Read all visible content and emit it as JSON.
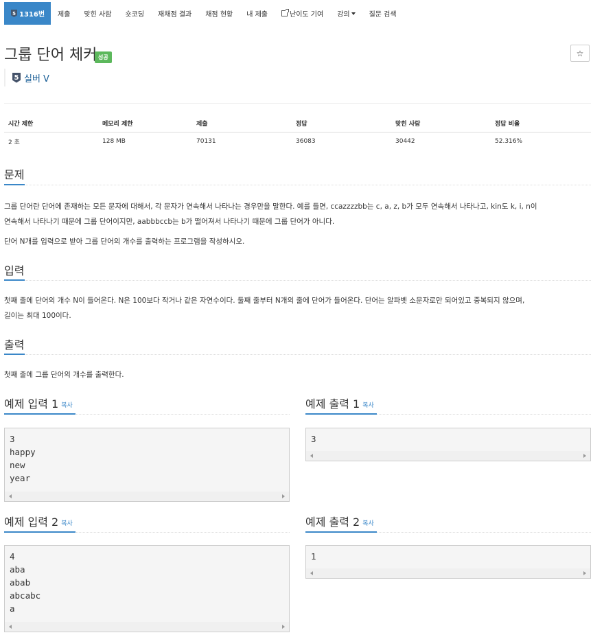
{
  "nav": {
    "problem_number": "1316번",
    "tier_badge": "5",
    "items": [
      "제출",
      "맞힌 사람",
      "숏코딩",
      "재채점 결과",
      "채점 현황",
      "내 제출",
      "난이도 기여",
      "강의",
      "질문 검색"
    ]
  },
  "problem": {
    "title": "그룹 단어 체커",
    "status_badge": "성공",
    "star_icon": "☆",
    "tier_number": "5",
    "tier_label": "실버 V"
  },
  "info_table": {
    "headers": [
      "시간 제한",
      "메모리 제한",
      "제출",
      "정답",
      "맞힌 사람",
      "정답 비율"
    ],
    "values": [
      "2 초",
      "128 MB",
      "70131",
      "36083",
      "30442",
      "52.316%"
    ]
  },
  "sections": {
    "description_title": "문제",
    "description_p1_line1": "그룹 단어란 단어에 존재하는 모든 문자에 대해서, 각 문자가 연속해서 나타나는 경우만을 말한다. 예를 들면, ccazzzzbb는 c, a, z, b가 모두 연속해서 나타나고, kin도 k, i, n이",
    "description_p1_line2": "연속해서 나타나기 때문에 그룹 단어이지만, aabbbccb는 b가 떨어져서 나타나기 때문에 그룹 단어가 아니다.",
    "description_p2": "단어 N개를 입력으로 받아 그룹 단어의 개수를 출력하는 프로그램을 작성하시오.",
    "input_title": "입력",
    "input_line1": "첫째 줄에 단어의 개수 N이 들어온다. N은 100보다 작거나 같은 자연수이다. 둘째 줄부터 N개의 줄에 단어가 들어온다. 단어는 알파벳 소문자로만 되어있고 중복되지 않으며,",
    "input_line2": "길이는 최대 100이다.",
    "output_title": "출력",
    "output_text": "첫째 줄에 그룹 단어의 개수를 출력한다."
  },
  "examples": [
    {
      "title": "예제 입력 1",
      "copy": "복사",
      "content": "3\nhappy\nnew\nyear"
    },
    {
      "title": "예제 출력 1",
      "copy": "복사",
      "content": "3"
    },
    {
      "title": "예제 입력 2",
      "copy": "복사",
      "content": "4\naba\nabab\nabcabc\na"
    },
    {
      "title": "예제 출력 2",
      "copy": "복사",
      "content": "1"
    }
  ],
  "colors": {
    "accent": "#3a87c8",
    "success": "#5cb85c"
  }
}
